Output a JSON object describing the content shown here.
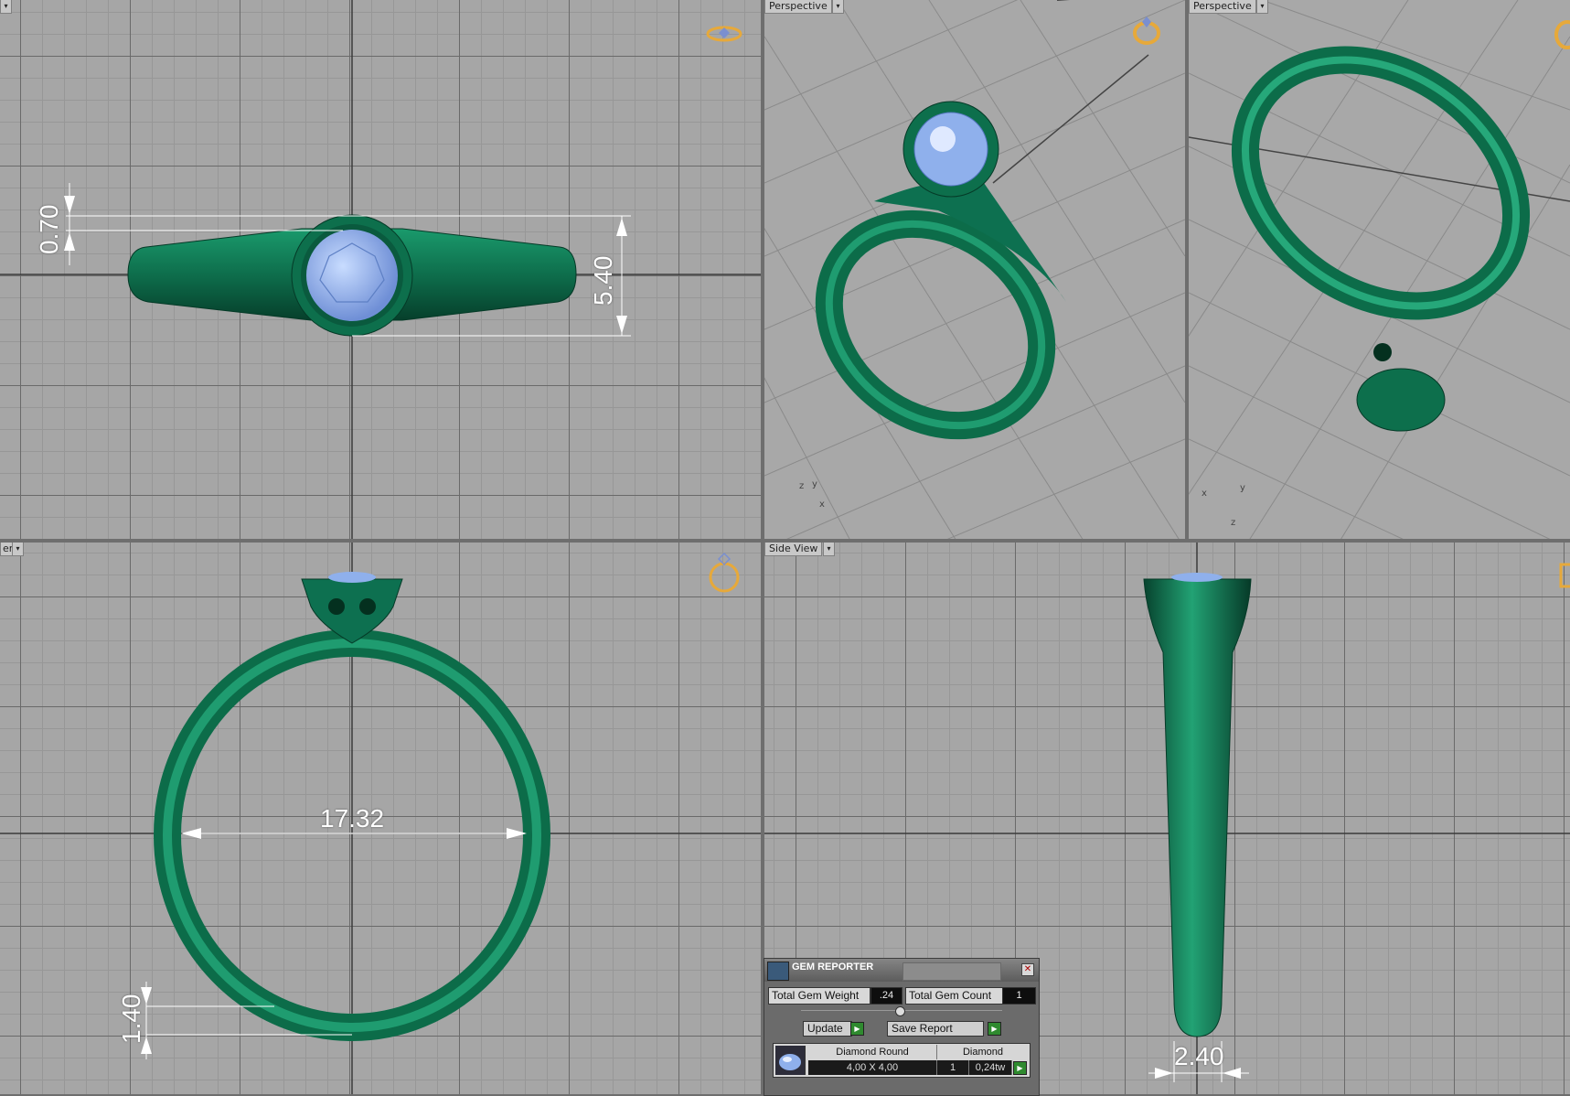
{
  "viewports": {
    "top": {
      "label": ""
    },
    "perspective_1": {
      "label": "Perspective",
      "axes": [
        "z",
        "y",
        "x"
      ]
    },
    "perspective_2": {
      "label": "Perspective",
      "axes": [
        "x",
        "y",
        "z"
      ]
    },
    "front": {
      "label": "er"
    },
    "side": {
      "label": "Side View"
    }
  },
  "dimensions": {
    "band_gap": "0.70",
    "head_height": "5.40",
    "inner_diameter": "17.32",
    "shank_thickness": "1.40",
    "shank_width": "2.40"
  },
  "gem_reporter": {
    "title": "GEM REPORTER",
    "close": "✕",
    "total_weight_label": "Total Gem Weight",
    "total_weight_value": ".24",
    "total_count_label": "Total Gem Count",
    "total_count_value": "1",
    "update_label": "Update",
    "save_report_label": "Save Report",
    "row": {
      "shape": "Diamond Round",
      "size": "4,00 X 4,00",
      "material": "Diamond",
      "count": "1",
      "weight": "0,24tw"
    }
  },
  "colors": {
    "ring_green": "#0f7a55",
    "gem_blue": "#8fb0ec",
    "viewport_bg": "#a6a6a6",
    "gizmo_orange": "#e7a93a"
  }
}
